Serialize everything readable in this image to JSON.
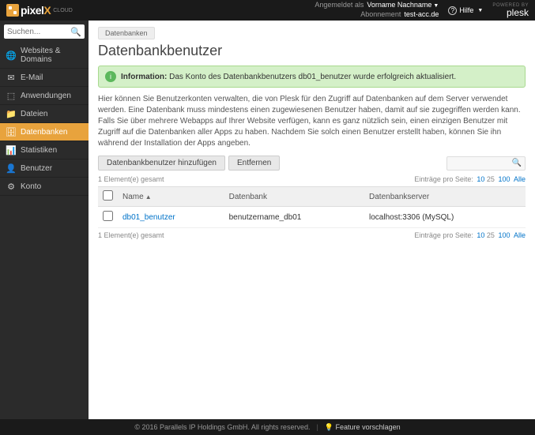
{
  "header": {
    "logo_text": "pixel",
    "logo_suffix": "X",
    "logo_cloud": "CLOUD",
    "logged_in_label": "Angemeldet als",
    "user_name": "Vorname Nachname",
    "subscription_label": "Abonnement",
    "subscription_value": "test-acc.de",
    "help_label": "Hilfe",
    "powered_by": "POWERED BY",
    "plesk": "plesk"
  },
  "search": {
    "placeholder": "Suchen..."
  },
  "nav": {
    "items": [
      {
        "label": "Websites & Domains",
        "icon": "🌐"
      },
      {
        "label": "E-Mail",
        "icon": "✉"
      },
      {
        "label": "Anwendungen",
        "icon": "⬚"
      },
      {
        "label": "Dateien",
        "icon": "📁"
      },
      {
        "label": "Datenbanken",
        "icon": "🗄"
      },
      {
        "label": "Statistiken",
        "icon": "📊"
      },
      {
        "label": "Benutzer",
        "icon": "👤"
      },
      {
        "label": "Konto",
        "icon": "⚙"
      }
    ]
  },
  "breadcrumb": {
    "item": "Datenbanken"
  },
  "page": {
    "title": "Datenbankbenutzer"
  },
  "alert": {
    "prefix": "Information:",
    "message": " Das Konto des Datenbankbenutzers db01_benutzer wurde erfolgreich aktualisiert."
  },
  "description": "Hier können Sie Benutzerkonten verwalten, die von Plesk für den Zugriff auf Datenbanken auf dem Server verwendet werden. Eine Datenbank muss mindestens einen zugewiesenen Benutzer haben, damit auf sie zugegriffen werden kann. Falls Sie über mehrere Webapps auf Ihrer Website verfügen, kann es ganz nützlich sein, einen einzigen Benutzer mit Zugriff auf die Datenbanken aller Apps zu haben. Nachdem Sie solch einen Benutzer erstellt haben, können Sie ihn während der Installation der Apps angeben.",
  "toolbar": {
    "add_label": "Datenbankbenutzer hinzufügen",
    "remove_label": "Entfernen"
  },
  "list": {
    "count_text": "1 Element(e) gesamt",
    "per_page_label": "Einträge pro Seite:",
    "p10": "10",
    "p25": "25",
    "p100": "100",
    "pall": "Alle",
    "columns": {
      "name": "Name",
      "database": "Datenbank",
      "server": "Datenbankserver"
    },
    "rows": [
      {
        "name": "db01_benutzer",
        "database": "benutzername_db01",
        "server": "localhost:3306 (MySQL)"
      }
    ]
  },
  "footer": {
    "copyright": "© 2016 Parallels IP Holdings GmbH. All rights reserved.",
    "suggest": "Feature vorschlagen"
  }
}
